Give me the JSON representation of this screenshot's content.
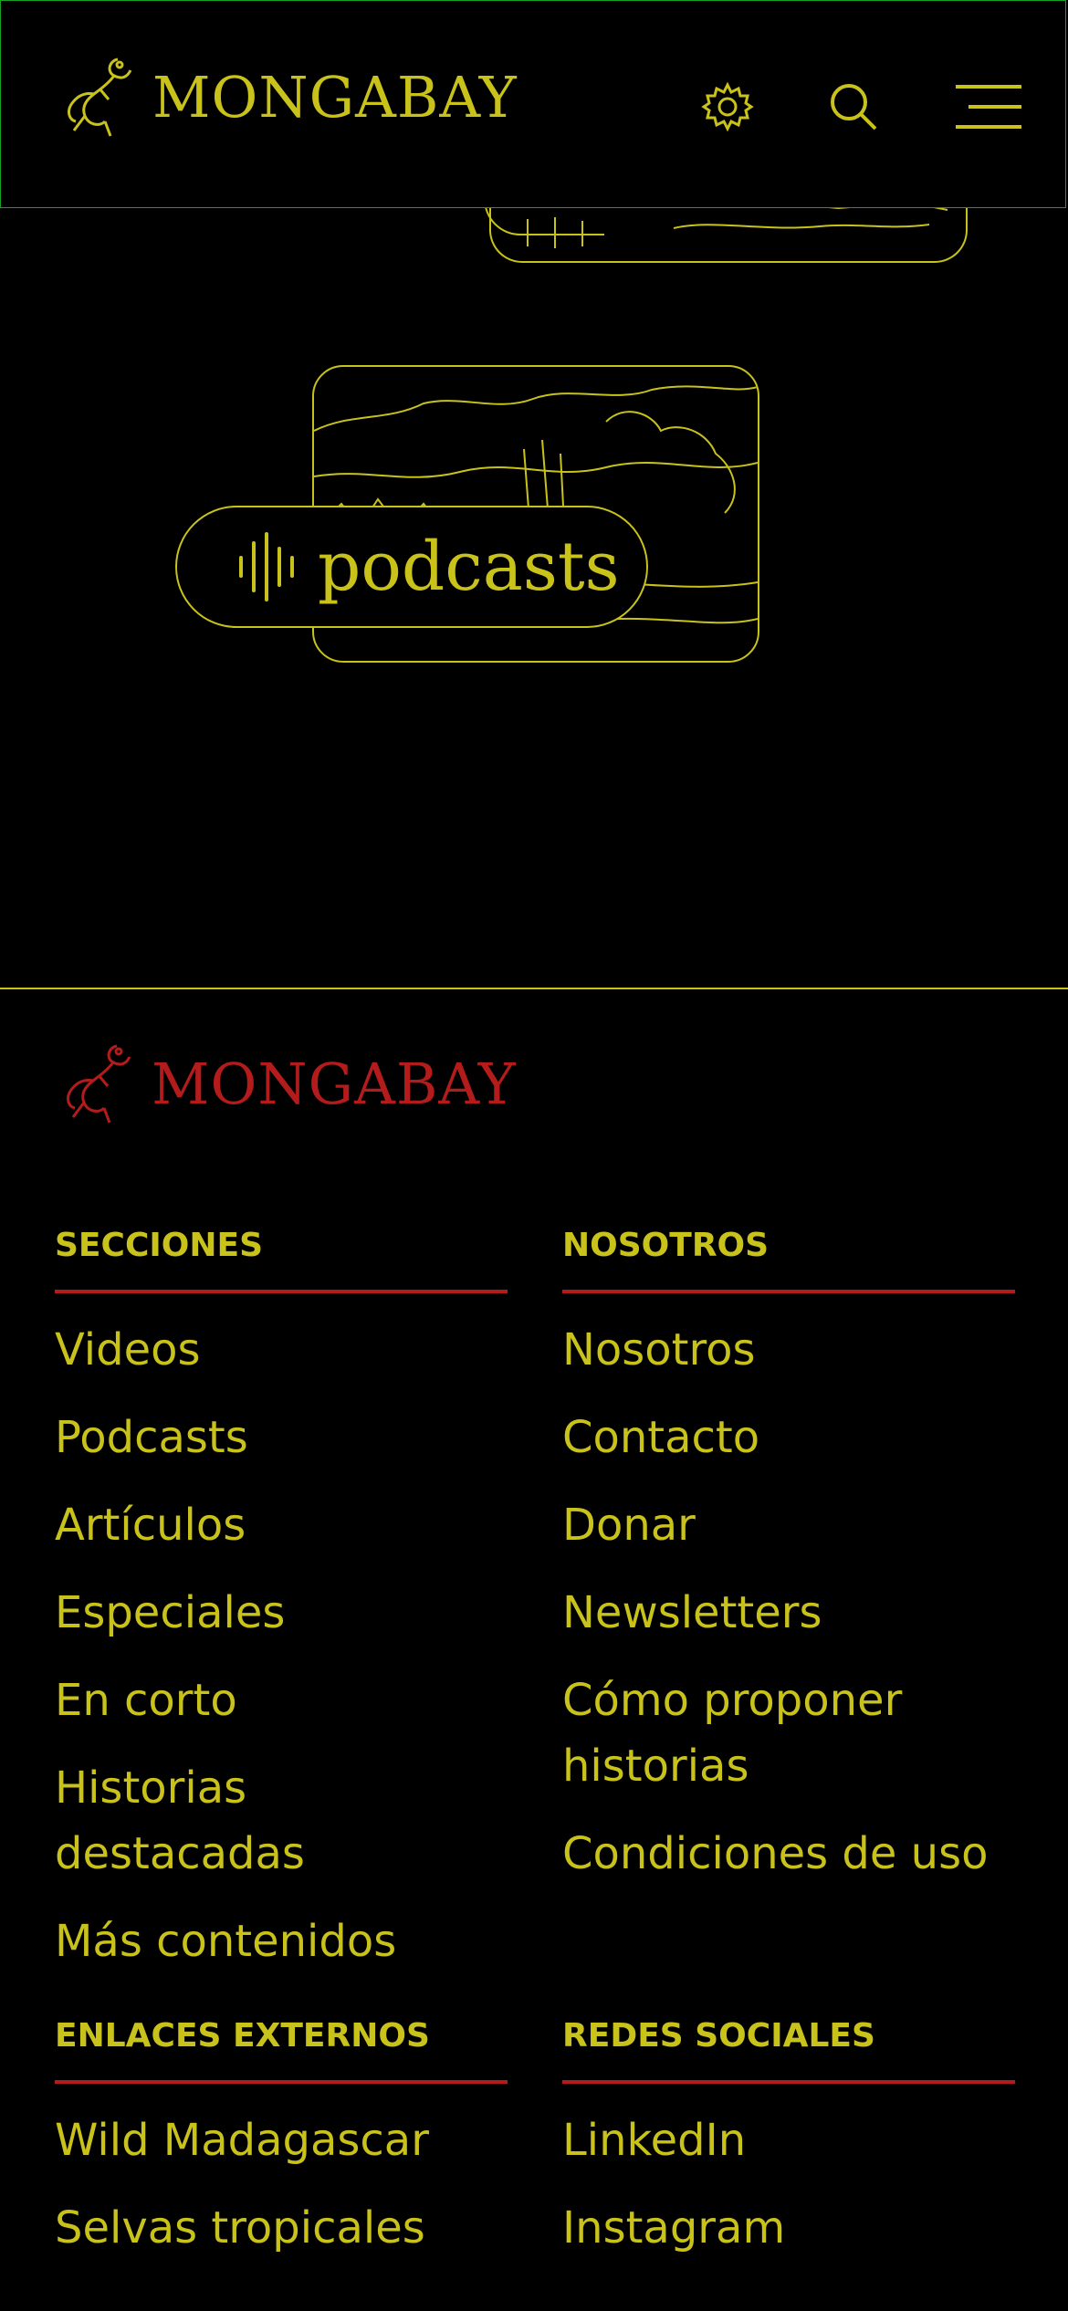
{
  "header": {
    "brand": "MONGABAY",
    "icons": [
      "gecko-logo-icon",
      "gear-icon",
      "search-icon",
      "menu-icon"
    ]
  },
  "podcasts": {
    "label": "podcasts"
  },
  "footer": {
    "brand": "MONGABAY",
    "secciones": {
      "heading": "SECCIONES",
      "items": [
        "Videos",
        "Podcasts",
        "Artículos",
        "Especiales",
        "En corto",
        "Historias destacadas",
        "Más contenidos"
      ]
    },
    "nosotros": {
      "heading": "NOSOTROS",
      "items": [
        "Nosotros",
        "Contacto",
        "Donar",
        "Newsletters",
        "Cómo proponer historias",
        "Condiciones de uso"
      ]
    },
    "enlaces": {
      "heading": "ENLACES EXTERNOS",
      "items": [
        "Wild Madagascar",
        "Selvas tropicales"
      ]
    },
    "redes": {
      "heading": "REDES SOCIALES",
      "items": [
        "LinkedIn",
        "Instagram"
      ]
    }
  },
  "colors": {
    "background": "#000000",
    "text": "#c9c21a",
    "accent": "#b41c1c",
    "header_border": "#15a026"
  }
}
